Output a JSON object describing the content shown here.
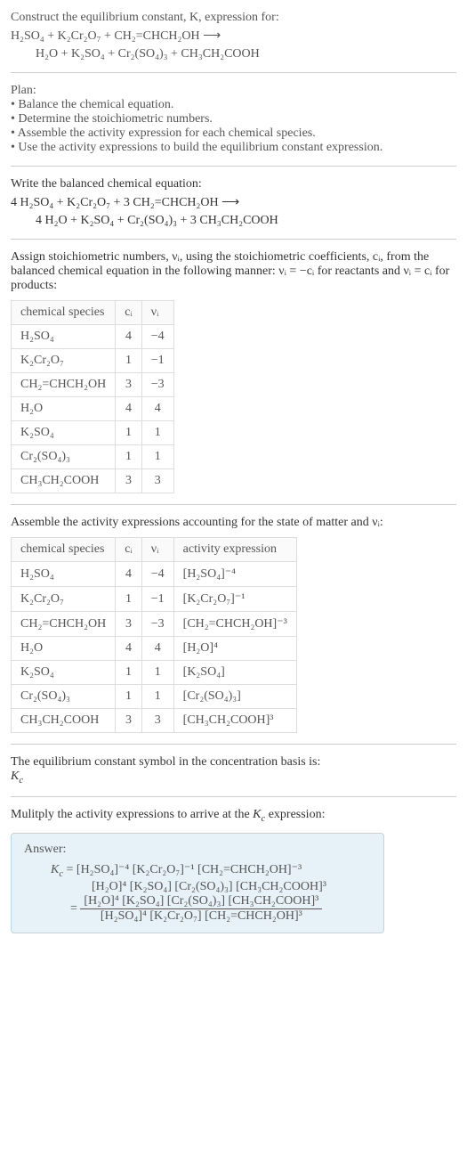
{
  "intro": {
    "line1": "Construct the equilibrium constant, K, expression for:",
    "reaction_lhs": "H₂SO₄ + K₂Cr₂O₇ + CH₂=CHCH₂OH ⟶",
    "reaction_rhs": "H₂O + K₂SO₄ + Cr₂(SO₄)₃ + CH₃CH₂COOH"
  },
  "plan": {
    "title": "Plan:",
    "items": [
      "• Balance the chemical equation.",
      "• Determine the stoichiometric numbers.",
      "• Assemble the activity expression for each chemical species.",
      "• Use the activity expressions to build the equilibrium constant expression."
    ]
  },
  "balanced": {
    "intro": "Write the balanced chemical equation:",
    "lhs": "4 H₂SO₄ + K₂Cr₂O₇ + 3 CH₂=CHCH₂OH ⟶",
    "rhs": "4 H₂O + K₂SO₄ + Cr₂(SO₄)₃ + 3 CH₃CH₂COOH"
  },
  "stoich": {
    "intro": "Assign stoichiometric numbers, νᵢ, using the stoichiometric coefficients, cᵢ, from the balanced chemical equation in the following manner: νᵢ = −cᵢ for reactants and νᵢ = cᵢ for products:",
    "headers": [
      "chemical species",
      "cᵢ",
      "νᵢ"
    ],
    "rows": [
      {
        "sp": "H₂SO₄",
        "c": "4",
        "v": "−4"
      },
      {
        "sp": "K₂Cr₂O₇",
        "c": "1",
        "v": "−1"
      },
      {
        "sp": "CH₂=CHCH₂OH",
        "c": "3",
        "v": "−3"
      },
      {
        "sp": "H₂O",
        "c": "4",
        "v": "4"
      },
      {
        "sp": "K₂SO₄",
        "c": "1",
        "v": "1"
      },
      {
        "sp": "Cr₂(SO₄)₃",
        "c": "1",
        "v": "1"
      },
      {
        "sp": "CH₃CH₂COOH",
        "c": "3",
        "v": "3"
      }
    ]
  },
  "activity": {
    "intro": "Assemble the activity expressions accounting for the state of matter and νᵢ:",
    "headers": [
      "chemical species",
      "cᵢ",
      "νᵢ",
      "activity expression"
    ],
    "rows": [
      {
        "sp": "H₂SO₄",
        "c": "4",
        "v": "−4",
        "a": "[H₂SO₄]⁻⁴"
      },
      {
        "sp": "K₂Cr₂O₇",
        "c": "1",
        "v": "−1",
        "a": "[K₂Cr₂O₇]⁻¹"
      },
      {
        "sp": "CH₂=CHCH₂OH",
        "c": "3",
        "v": "−3",
        "a": "[CH₂=CHCH₂OH]⁻³"
      },
      {
        "sp": "H₂O",
        "c": "4",
        "v": "4",
        "a": "[H₂O]⁴"
      },
      {
        "sp": "K₂SO₄",
        "c": "1",
        "v": "1",
        "a": "[K₂SO₄]"
      },
      {
        "sp": "Cr₂(SO₄)₃",
        "c": "1",
        "v": "1",
        "a": "[Cr₂(SO₄)₃]"
      },
      {
        "sp": "CH₃CH₂COOH",
        "c": "3",
        "v": "3",
        "a": "[CH₃CH₂COOH]³"
      }
    ]
  },
  "kc_symbol": {
    "intro": "The equilibrium constant symbol in the concentration basis is:",
    "sym": "K_c"
  },
  "multiply": {
    "intro": "Mulitply the activity expressions to arrive at the K_c expression:"
  },
  "answer": {
    "title": "Answer:",
    "line1": "K_c = [H₂SO₄]⁻⁴ [K₂Cr₂O₇]⁻¹ [CH₂=CHCH₂OH]⁻³",
    "line2": "[H₂O]⁴ [K₂SO₄] [Cr₂(SO₄)₃] [CH₃CH₂COOH]³",
    "frac_num": "[H₂O]⁴ [K₂SO₄] [Cr₂(SO₄)₃] [CH₃CH₂COOH]³",
    "frac_den": "[H₂SO₄]⁴ [K₂Cr₂O₇] [CH₂=CHCH₂OH]³"
  },
  "chart_data": {
    "type": "table",
    "tables": [
      {
        "title": "stoichiometric numbers",
        "columns": [
          "chemical species",
          "cᵢ",
          "νᵢ"
        ],
        "rows": [
          [
            "H₂SO₄",
            "4",
            "−4"
          ],
          [
            "K₂Cr₂O₇",
            "1",
            "−1"
          ],
          [
            "CH₂=CHCH₂OH",
            "3",
            "−3"
          ],
          [
            "H₂O",
            "4",
            "4"
          ],
          [
            "K₂SO₄",
            "1",
            "1"
          ],
          [
            "Cr₂(SO₄)₃",
            "1",
            "1"
          ],
          [
            "CH₃CH₂COOH",
            "3",
            "3"
          ]
        ]
      },
      {
        "title": "activity expressions",
        "columns": [
          "chemical species",
          "cᵢ",
          "νᵢ",
          "activity expression"
        ],
        "rows": [
          [
            "H₂SO₄",
            "4",
            "−4",
            "[H₂SO₄]⁻⁴"
          ],
          [
            "K₂Cr₂O₇",
            "1",
            "−1",
            "[K₂Cr₂O₇]⁻¹"
          ],
          [
            "CH₂=CHCH₂OH",
            "3",
            "−3",
            "[CH₂=CHCH₂OH]⁻³"
          ],
          [
            "H₂O",
            "4",
            "4",
            "[H₂O]⁴"
          ],
          [
            "K₂SO₄",
            "1",
            "1",
            "[K₂SO₄]"
          ],
          [
            "Cr₂(SO₄)₃",
            "1",
            "1",
            "[Cr₂(SO₄)₃]"
          ],
          [
            "CH₃CH₂COOH",
            "3",
            "3",
            "[CH₃CH₂COOH]³"
          ]
        ]
      }
    ]
  }
}
